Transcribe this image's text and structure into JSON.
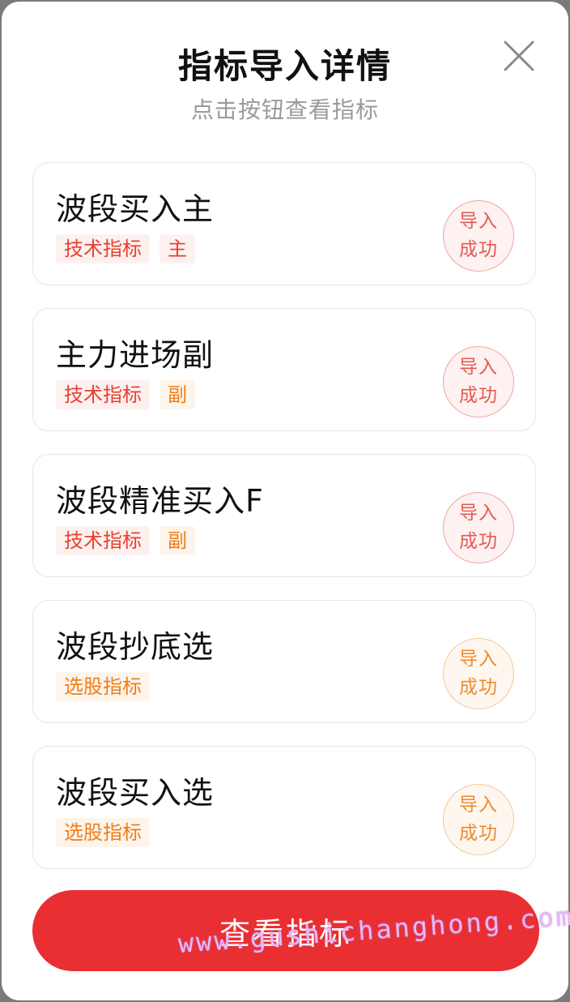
{
  "dialog": {
    "title": "指标导入详情",
    "subtitle": "点击按钮查看指标",
    "close_icon": "close-icon"
  },
  "items": [
    {
      "name": "波段买入主",
      "tags": [
        {
          "label": "技术指标",
          "color": "red"
        },
        {
          "label": "主",
          "color": "red"
        }
      ],
      "status_line1": "导入",
      "status_line2": "成功",
      "status_color": "red"
    },
    {
      "name": "主力进场副",
      "tags": [
        {
          "label": "技术指标",
          "color": "red"
        },
        {
          "label": "副",
          "color": "orange"
        }
      ],
      "status_line1": "导入",
      "status_line2": "成功",
      "status_color": "red"
    },
    {
      "name": "波段精准买入F",
      "tags": [
        {
          "label": "技术指标",
          "color": "red"
        },
        {
          "label": "副",
          "color": "orange"
        }
      ],
      "status_line1": "导入",
      "status_line2": "成功",
      "status_color": "red"
    },
    {
      "name": "波段抄底选",
      "tags": [
        {
          "label": "选股指标",
          "color": "orange"
        }
      ],
      "status_line1": "导入",
      "status_line2": "成功",
      "status_color": "orange"
    },
    {
      "name": "波段买入选",
      "tags": [
        {
          "label": "选股指标",
          "color": "orange"
        }
      ],
      "status_line1": "导入",
      "status_line2": "成功",
      "status_color": "orange"
    }
  ],
  "primary_button": {
    "label": "查看指标"
  },
  "watermark": "www.gushichanghong.com",
  "colors": {
    "accent_red": "#e92f32",
    "tag_red": "#e8412f",
    "tag_orange": "#f07d18"
  }
}
